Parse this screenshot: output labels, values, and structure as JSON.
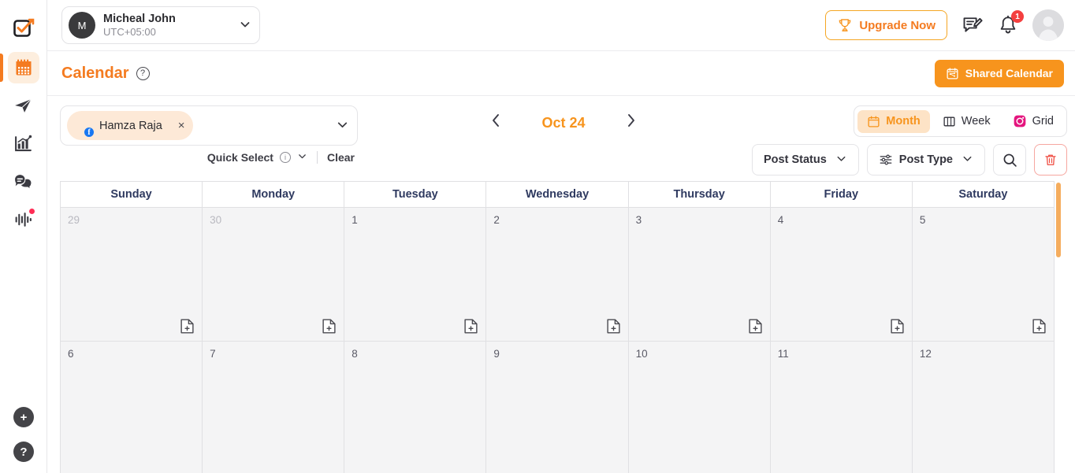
{
  "rail": {
    "logo_icon": "checkbox-logo-icon",
    "items": [
      {
        "name": "calendar",
        "icon": "calendar-icon",
        "active": true,
        "dot": false
      },
      {
        "name": "publish",
        "icon": "paper-plane-icon",
        "active": false,
        "dot": false
      },
      {
        "name": "analytics",
        "icon": "bar-chart-icon",
        "active": false,
        "dot": false
      },
      {
        "name": "inbox",
        "icon": "chat-bubbles-icon",
        "active": false,
        "dot": false
      },
      {
        "name": "listening",
        "icon": "audio-waveform-icon",
        "active": false,
        "dot": true
      }
    ],
    "bottom": [
      {
        "name": "add",
        "label": "+"
      },
      {
        "name": "help",
        "label": "?"
      }
    ]
  },
  "topbar": {
    "account": {
      "initial": "M",
      "name": "Micheal John",
      "timezone": "UTC+05:00",
      "chevron": "⌄"
    },
    "upgrade_label": "Upgrade Now",
    "upgrade_icon": "trophy-icon",
    "compose_icon": "compose-message-icon",
    "notifications_icon": "bell-icon",
    "notifications_count": "1",
    "avatar_icon": "user-avatar-icon"
  },
  "page": {
    "title": "Calendar",
    "help_glyph": "?",
    "shared_calendar_label": "Shared Calendar",
    "shared_calendar_icon": "shared-calendar-icon"
  },
  "toolbar": {
    "selected_account": {
      "name": "Hamza Raja",
      "network": "facebook",
      "network_glyph": "f",
      "remove_glyph": "×"
    },
    "dropdown_chevron": "⌄",
    "quick_select_label": "Quick Select",
    "quick_select_info": "i",
    "quick_select_chevron": "⌄",
    "clear_label": "Clear",
    "prev_glyph": "‹",
    "next_glyph": "›",
    "date_label": "Oct 24",
    "views": [
      {
        "label": "Month",
        "icon": "calendar-outline-icon",
        "active": true
      },
      {
        "label": "Week",
        "icon": "columns-icon",
        "active": false
      },
      {
        "label": "Grid",
        "icon": "instagram-icon",
        "active": false
      }
    ],
    "filters": [
      {
        "label": "Post Status",
        "icon": null,
        "chevron": "⌄"
      },
      {
        "label": "Post Type",
        "icon": "sliders-icon",
        "chevron": "⌄"
      }
    ],
    "search_icon": "search-icon",
    "delete_icon": "trash-icon"
  },
  "calendar": {
    "day_headers": [
      "Sunday",
      "Monday",
      "Tuesday",
      "Wednesday",
      "Thursday",
      "Friday",
      "Saturday"
    ],
    "add_post_icon": "add-post-file-icon",
    "weeks": [
      [
        {
          "day": "29",
          "other_month": true
        },
        {
          "day": "30",
          "other_month": true
        },
        {
          "day": "1",
          "other_month": false
        },
        {
          "day": "2",
          "other_month": false
        },
        {
          "day": "3",
          "other_month": false
        },
        {
          "day": "4",
          "other_month": false
        },
        {
          "day": "5",
          "other_month": false
        }
      ],
      [
        {
          "day": "6",
          "other_month": false
        },
        {
          "day": "7",
          "other_month": false
        },
        {
          "day": "8",
          "other_month": false
        },
        {
          "day": "9",
          "other_month": false
        },
        {
          "day": "10",
          "other_month": false
        },
        {
          "day": "11",
          "other_month": false
        },
        {
          "day": "12",
          "other_month": false
        }
      ]
    ]
  },
  "colors": {
    "accent_orange": "#f7941d",
    "accent_orange_dark": "#f47b20",
    "chip_bg": "#fde9d7",
    "cell_bg": "#f4f4f5",
    "header_text": "#2f3a60",
    "badge_red": "#f43f3f",
    "facebook_blue": "#1877f2",
    "instagram_pink": "#e4157e"
  }
}
